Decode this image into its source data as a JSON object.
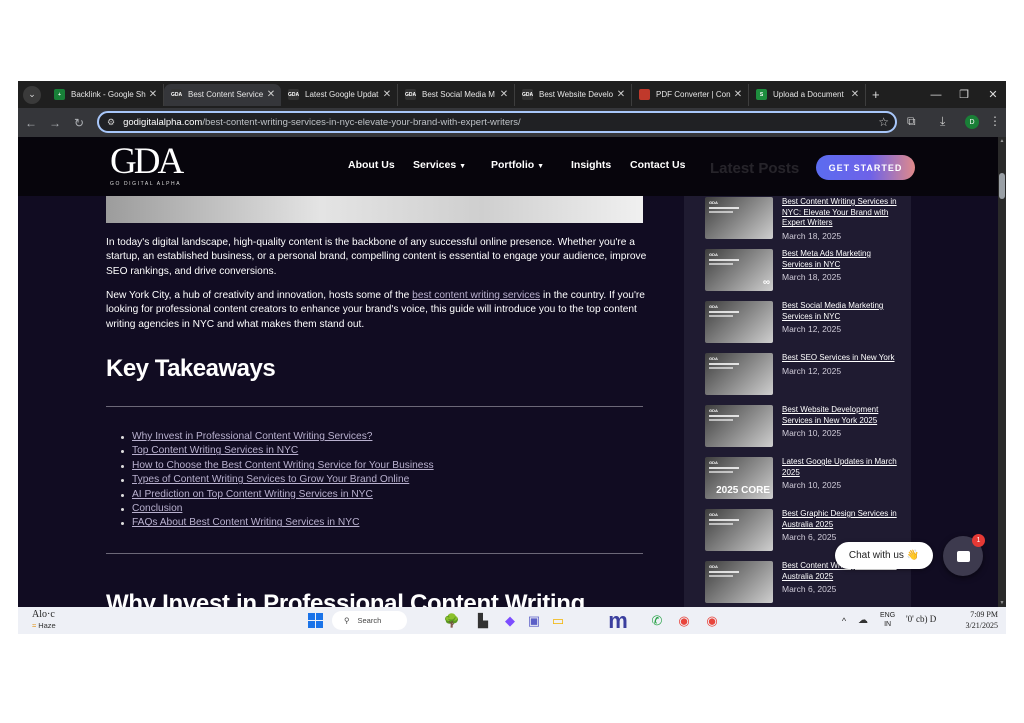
{
  "browser": {
    "tabs": [
      {
        "title": "Backlink - Google Sh",
        "favicon_color": "#188038",
        "favicon_text": "+"
      },
      {
        "title": "Best Content Service",
        "favicon_color": "#333333",
        "favicon_text": "GDA",
        "active": true
      },
      {
        "title": "Latest Google Updat",
        "favicon_color": "#333333",
        "favicon_text": "GDA"
      },
      {
        "title": "Best Social Media M",
        "favicon_color": "#333333",
        "favicon_text": "GDA"
      },
      {
        "title": "Best Website Develo",
        "favicon_color": "#333333",
        "favicon_text": "GDA"
      },
      {
        "title": "PDF Converter | Con",
        "favicon_color": "#c0392b",
        "favicon_text": ""
      },
      {
        "title": "Upload a Document",
        "favicon_color": "#1e8e3e",
        "favicon_text": "S"
      }
    ],
    "close_glyph": "✕",
    "new_tab_glyph": "+",
    "url_host": "godigitalalpha.com",
    "url_path": "/best-content-writing-services-in-nyc-elevate-your-brand-with-expert-writers/",
    "profile_initial": "D"
  },
  "site": {
    "logo_mark": "GDA",
    "logo_sub": "GO DIGITAL ALPHA",
    "nav": [
      {
        "label": "About Us",
        "dropdown": false
      },
      {
        "label": "Services",
        "dropdown": true
      },
      {
        "label": "Portfolio",
        "dropdown": true
      },
      {
        "label": "Insights",
        "dropdown": false
      },
      {
        "label": "Contact Us",
        "dropdown": false
      }
    ],
    "cta_label": "GET STARTED",
    "sidebar_ghost_heading": "Latest Posts"
  },
  "article": {
    "para1": "In today's digital landscape, high-quality content is the backbone of any successful online  presence. Whether you're a startup, an established business, or a personal brand, compelling  content is essential to engage your audience, improve SEO rankings, and drive conversions.",
    "para2_before": "New York City, a hub of creativity and innovation, hosts some of the ",
    "para2_link": "best content writing  services",
    "para2_after": " in the country. If you're looking for professional content creators to enhance your  brand's voice, this guide will introduce you to the top content writing agencies in NYC and  what makes them stand out.",
    "key_takeaways_title": "Key Takeaways",
    "toc": [
      "Why Invest in Professional Content Writing Services?",
      "Top Content Writing Services in NYC",
      "How to Choose the Best Content Writing Service for Your Business",
      "Types of Content Writing Services to Grow Your Brand Online",
      "AI Prediction on Top Content Writing Services in NYC",
      "Conclusion",
      "FAQs About Best Content Writing Services in NYC"
    ],
    "next_heading": "Why Invest in Professional Content Writing"
  },
  "sidebar_posts": [
    {
      "title": "Best Content Writing Services in NYC: Elevate Your Brand with Expert Writers",
      "date": "March 18, 2025",
      "thumb_big": ""
    },
    {
      "title": "Best Meta Ads Marketing Services in NYC",
      "date": "March 18, 2025",
      "thumb_big": "∞"
    },
    {
      "title": "Best Social Media Marketing Services in NYC",
      "date": "March 12, 2025",
      "thumb_big": ""
    },
    {
      "title": "Best SEO Services in New York",
      "date": "March 12, 2025",
      "thumb_big": ""
    },
    {
      "title": "Best Website Development Services in New York 2025",
      "date": "March 10, 2025",
      "thumb_big": ""
    },
    {
      "title": "Latest Google Updates in March 2025",
      "date": "March 10, 2025",
      "thumb_big": "2025 CORE"
    },
    {
      "title": "Best Graphic Design Services in Australia 2025",
      "date": "March 6, 2025",
      "thumb_big": ""
    },
    {
      "title": "Best Content Writing Services in Australia 2025",
      "date": "March 6, 2025",
      "thumb_big": ""
    }
  ],
  "chat": {
    "label": "Chat with us 👋",
    "badge": "1"
  },
  "taskbar": {
    "weather_temp": "Alo·c",
    "weather_cond": "Haze",
    "search_placeholder": "Search",
    "tray_lang1": "ENG",
    "tray_lang2": "IN",
    "tray_icons": "'0' cb) D",
    "time": "7:09 PM",
    "date": "3/21/2025"
  }
}
